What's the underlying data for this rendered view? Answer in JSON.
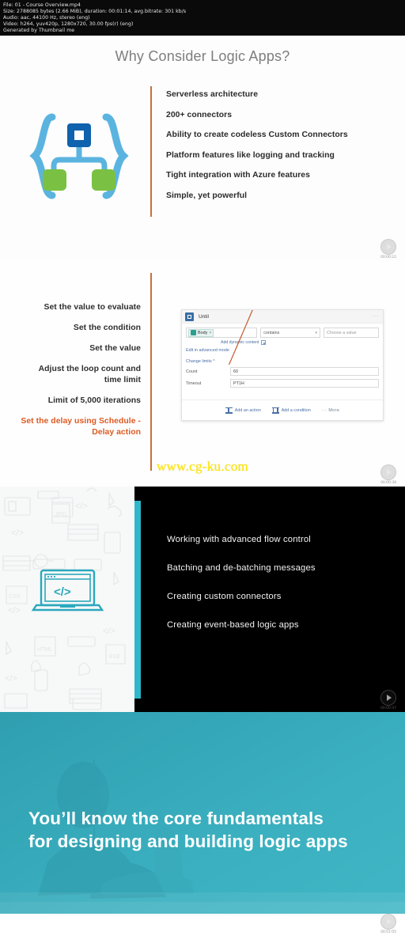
{
  "meta": {
    "lines": [
      "File: 01 - Course Overview.mp4",
      "Size: 2788085 bytes (2.66 MiB), duration: 00:01:14, avg.bitrate: 301 kb/s",
      "Audio: aac, 44100 Hz, stereo (eng)",
      "Video: h264, yuv420p, 1280x720, 30.00 fps(r) (eng)",
      "Generated by Thumbnail me"
    ]
  },
  "slide1": {
    "title": "Why Consider Logic Apps?",
    "bullets": [
      "Serverless architecture",
      "200+ connectors",
      "Ability to create codeless Custom Connectors",
      "Platform features like logging and tracking",
      "Tight integration with Azure features",
      "Simple, yet powerful"
    ],
    "timestamp": "00:00:22"
  },
  "slide2": {
    "bullets": [
      "Set the value to evaluate",
      "Set the condition",
      "Set the value",
      "Adjust the loop count and time limit",
      "Limit of 5,000 iterations",
      "Set the delay using Schedule - Delay action"
    ],
    "accent_index": 5,
    "card": {
      "title": "Until",
      "token_label": "Body",
      "token_close": "×",
      "operator": "contains",
      "value_placeholder": "Choose a value",
      "dynamic_content": "Add dynamic content",
      "advanced_mode": "Edit in advanced mode",
      "change_limits": "Change limits",
      "count_label": "Count",
      "count_value": "60",
      "timeout_label": "Timeout",
      "timeout_value": "PT1H",
      "add_action": "Add an action",
      "add_condition": "Add a condition",
      "more": "More",
      "menu_dots": "···"
    },
    "timestamp": "00:00:38"
  },
  "watermark": "www.cg-ku.com",
  "slide3": {
    "bullets": [
      "Working with advanced flow control",
      "Batching and de-batching messages",
      "Creating custom connectors",
      "Creating event-based logic apps"
    ],
    "code_glyph": "</>",
    "timestamp": "00:00:47"
  },
  "slide4": {
    "title_line1": "You’ll know the core fundamentals",
    "title_line2": "for designing and building logic apps",
    "timestamp": "00:01:05"
  },
  "colors": {
    "accent_orange": "#dd5a23",
    "rule_orange": "#c8703a",
    "teal": "#3aafbf",
    "strip_teal": "#2fb6c9",
    "icon_blue": "#5bb4e0",
    "icon_darkblue": "#0f62ad",
    "icon_green": "#7ac143",
    "watermark_yellow": "#ffe600"
  }
}
